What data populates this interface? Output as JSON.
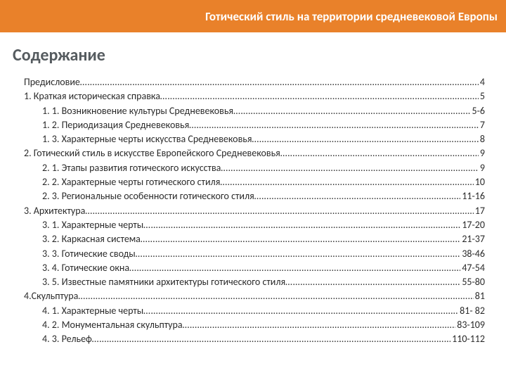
{
  "header": {
    "title": "Готический стиль на территории средневековой Европы"
  },
  "content_title": "Содержание",
  "toc": [
    {
      "level": 1,
      "label": "Предисловие",
      "page": "4"
    },
    {
      "level": 1,
      "label": "1. Краткая историческая справка",
      "page": "5"
    },
    {
      "level": 2,
      "label": "1. 1. Возникновение культуры Средневековья",
      "page": "5-6"
    },
    {
      "level": 2,
      "label": "1. 2. Периодизация Средневековья",
      "page": "7"
    },
    {
      "level": 2,
      "label": "1. 3. Характерные черты искусства Средневековья",
      "page": "8"
    },
    {
      "level": 1,
      "label": "2. Готический стиль в искусстве Европейского Средневековья",
      "page": "9"
    },
    {
      "level": 2,
      "label": "2. 1. Этапы развития готического искусства",
      "page": "9"
    },
    {
      "level": 2,
      "label": "2. 2. Характерные черты готического стиля",
      "page": "10"
    },
    {
      "level": 2,
      "label": "2. 3. Региональные особенности готического стиля",
      "page": "11-16"
    },
    {
      "level": 1,
      "label": "3. Архитектура",
      "page": "17"
    },
    {
      "level": 2,
      "label": "3. 1. Характерные черты",
      "page": "17-20"
    },
    {
      "level": 2,
      "label": "3. 2. Каркасная система",
      "page": "21-37"
    },
    {
      "level": 2,
      "label": "3. 3. Готические своды",
      "page": "38-46"
    },
    {
      "level": 2,
      "label": " 3. 4. Готические окна",
      "page": "47-54"
    },
    {
      "level": 2,
      "label": "3. 5. Известные памятники архитектуры готического стиля",
      "page": "55-80"
    },
    {
      "level": 1,
      "label": "4.Скульптура",
      "page": "81"
    },
    {
      "level": 2,
      "label": "4. 1. Характерные черты",
      "page": "81- 82"
    },
    {
      "level": 2,
      "label": "4. 2. Монументальная скульптура",
      "page": "83-109"
    },
    {
      "level": 2,
      "label": "4. 3. Рельеф",
      "page": "110-112"
    }
  ]
}
